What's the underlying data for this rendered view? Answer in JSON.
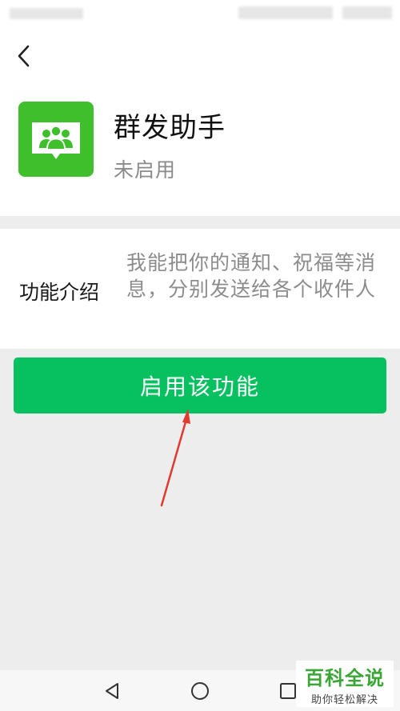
{
  "app": {
    "name": "群发助手",
    "status": "未启用",
    "accent": "#07c160",
    "icon_bg": "#3fbf2c"
  },
  "nav": {
    "back_icon": "chevron-left-icon"
  },
  "description": {
    "label": "功能介绍",
    "text": "我能把你的通知、祝福等消息，分别发送给各个收件人"
  },
  "action": {
    "enable_label": "启用该功能"
  },
  "system_nav": {
    "icons": [
      "triangle-back-icon",
      "circle-home-icon",
      "square-recents-icon"
    ]
  },
  "watermark": {
    "title": "百科全说",
    "subtitle": "助你轻松解决"
  }
}
